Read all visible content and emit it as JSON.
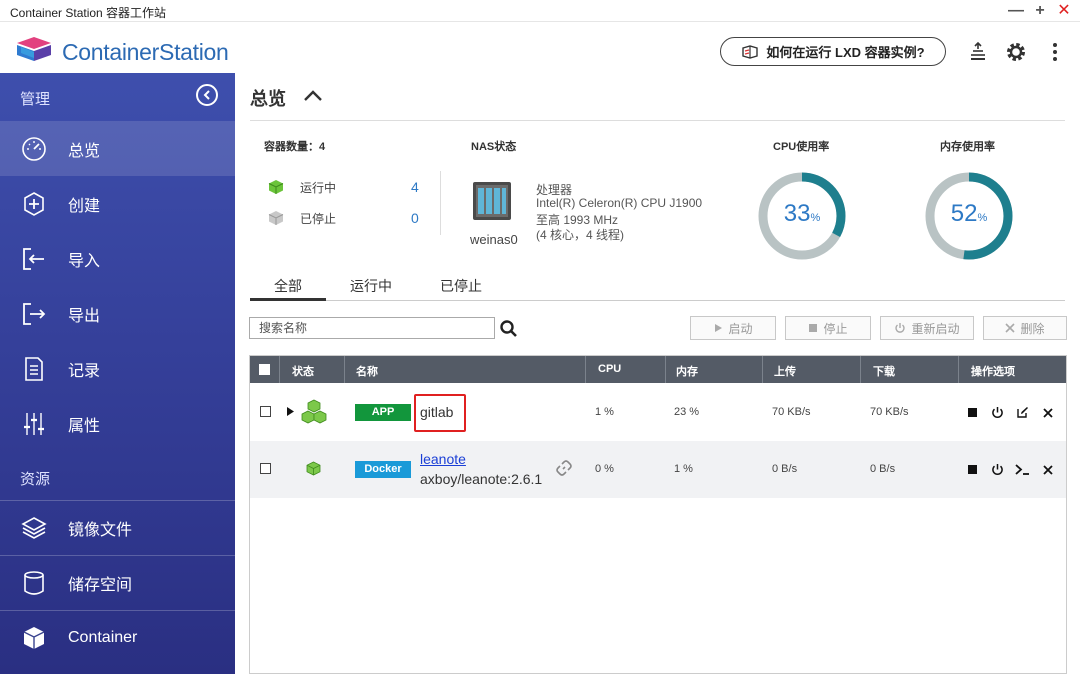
{
  "window": {
    "title": "Container Station 容器工作站",
    "minimize": "—",
    "maximize": "+",
    "close": "✕"
  },
  "header": {
    "logo_text": "ContainerStation",
    "lxd_help": "如何在运行 LXD 容器实例?",
    "icons": [
      "install-icon",
      "gear-icon",
      "more-icon"
    ]
  },
  "sidebar": {
    "manage_label": "管理",
    "resources_label": "资源",
    "manage_items": [
      {
        "label": "总览",
        "icon": "dashboard-icon",
        "active": true
      },
      {
        "label": "创建",
        "icon": "plus-circle-icon"
      },
      {
        "label": "导入",
        "icon": "import-icon"
      },
      {
        "label": "导出",
        "icon": "export-icon"
      },
      {
        "label": "记录",
        "icon": "document-icon"
      },
      {
        "label": "属性",
        "icon": "sliders-icon"
      }
    ],
    "resource_items": [
      {
        "label": "镜像文件",
        "icon": "layers-icon"
      },
      {
        "label": "储存空间",
        "icon": "storage-icon"
      },
      {
        "label": "Container",
        "icon": "cube-icon"
      }
    ]
  },
  "overview": {
    "title": "总览",
    "container_count_label": "容器数量：4",
    "running_label": "运行中",
    "running_count": "4",
    "stopped_label": "已停止",
    "stopped_count": "0",
    "nas_label": "NAS状态",
    "nas_name": "weinas0",
    "processor_title": "处理器",
    "processor_model": "Intel(R) Celeron(R) CPU J1900",
    "processor_freq": "至高 1993 MHz",
    "processor_cores": "(4 核心，4 线程)",
    "cpu_label": "CPU使用率",
    "cpu_value": 33,
    "mem_label": "内存使用率",
    "mem_value": 52,
    "percent_unit": "%"
  },
  "tabs": [
    {
      "label": "全部",
      "active": true
    },
    {
      "label": "运行中"
    },
    {
      "label": "已停止"
    }
  ],
  "toolbar": {
    "search_placeholder": "搜索名称",
    "start": "启动",
    "stop": "停止",
    "restart": "重新启动",
    "delete": "删除"
  },
  "table": {
    "headers": {
      "status": "状态",
      "name": "名称",
      "cpu": "CPU",
      "memory": "内存",
      "upload": "上传",
      "download": "下载",
      "ops": "操作选项"
    },
    "rows": [
      {
        "type": "APP",
        "type_color": "#12963c",
        "name": "gitlab",
        "cpu": "1 %",
        "memory": "23 %",
        "upload": "70 KB/s",
        "download": "70 KB/s"
      },
      {
        "type": "Docker",
        "type_color": "#1a9ad8",
        "name": "leanote",
        "image": "axboy/leanote:2.6.1",
        "cpu": "0 %",
        "memory": "1 %",
        "upload": "0 B/s",
        "download": "0 B/s"
      }
    ]
  },
  "colors": {
    "accent": "#2d79c5",
    "sidebar": "#3a48a4",
    "highlight": "#e02020",
    "gauge_track": "#b9c3c4",
    "gauge_fill": "#1e7f8e"
  }
}
